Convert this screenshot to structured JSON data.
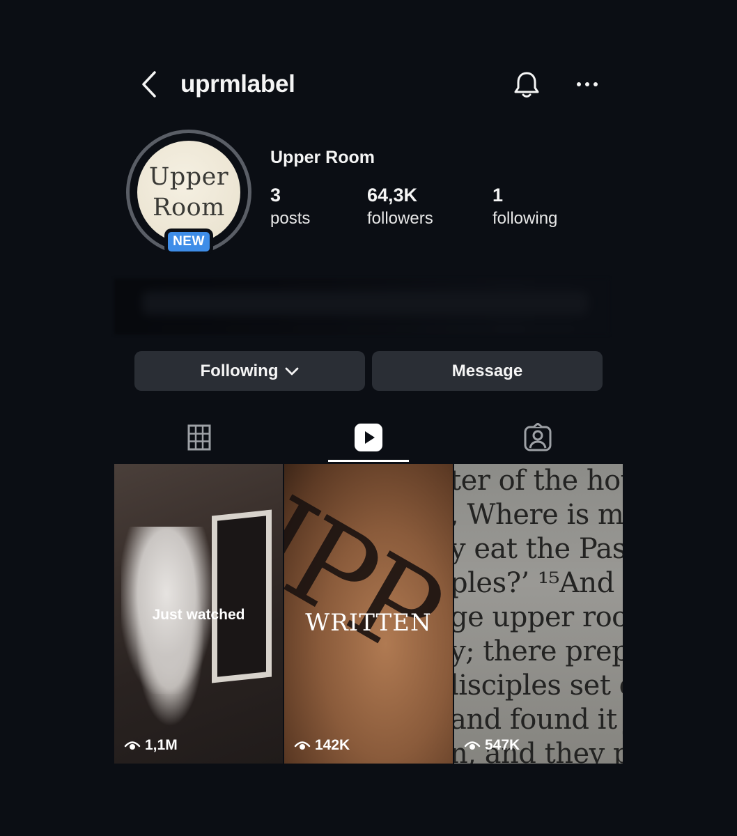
{
  "header": {
    "username": "uprmlabel",
    "back_icon": "chevron-left-icon",
    "notification_icon": "bell-icon",
    "more_icon": "more-horizontal-icon"
  },
  "profile": {
    "avatar_text_line1": "Upper",
    "avatar_text_line2": "Room",
    "badge": "NEW",
    "display_name": "Upper Room",
    "stats": {
      "posts": {
        "value": "3",
        "label": "posts"
      },
      "followers": {
        "value": "64,3K",
        "label": "followers"
      },
      "following": {
        "value": "1",
        "label": "following"
      }
    }
  },
  "actions": {
    "following_label": "Following",
    "message_label": "Message"
  },
  "tabs": [
    {
      "icon": "grid-icon",
      "active": false
    },
    {
      "icon": "reels-icon",
      "active": true
    },
    {
      "icon": "tagged-icon",
      "active": false
    }
  ],
  "reels": [
    {
      "title": "Just watched",
      "views": "1,1M"
    },
    {
      "title": "WRITTEN",
      "views": "142K"
    },
    {
      "title": "",
      "views": "547K"
    }
  ],
  "colors": {
    "background": "#0b0e14",
    "button": "#2a2e35",
    "badge": "#3e8de8"
  }
}
